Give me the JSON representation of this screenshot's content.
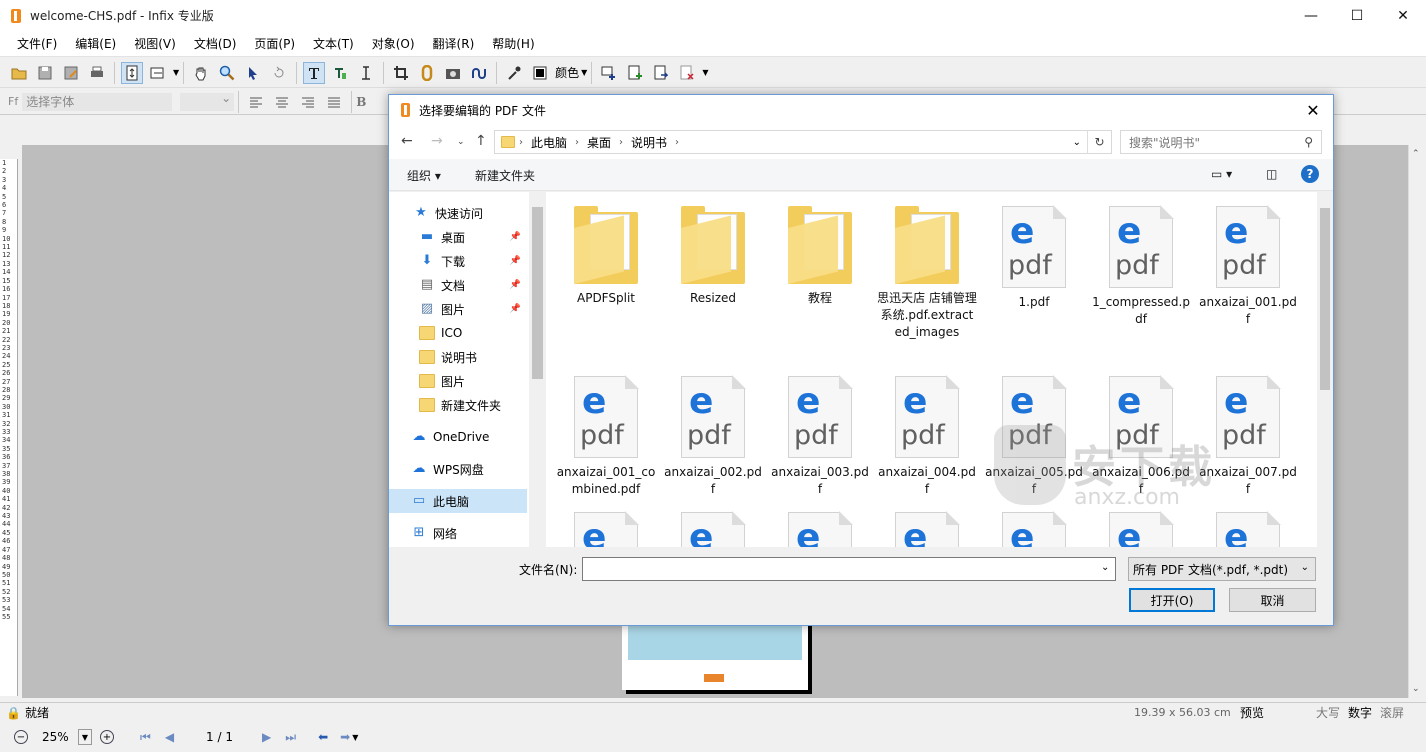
{
  "app": {
    "title": "welcome-CHS.pdf - Infix 专业版",
    "window_controls": [
      "minimize-icon",
      "maximize-icon",
      "close-icon"
    ]
  },
  "menu": [
    "文件(F)",
    "编辑(E)",
    "视图(V)",
    "文档(D)",
    "页面(P)",
    "文本(T)",
    "对象(O)",
    "翻译(R)",
    "帮助(H)"
  ],
  "toolbar": {
    "color_label": "颜色",
    "font_placeholder": "选择字体",
    "bold": "B"
  },
  "ruler_numbers": [
    "1",
    "2",
    "3",
    "4",
    "5",
    "6",
    "7",
    "8",
    "9",
    "10",
    "11",
    "12",
    "13",
    "14",
    "15",
    "16",
    "17",
    "18",
    "19",
    "20",
    "21",
    "22",
    "23",
    "24",
    "25",
    "26",
    "27",
    "28",
    "29",
    "30",
    "31",
    "32",
    "33",
    "34",
    "35",
    "36",
    "37",
    "38",
    "39",
    "40",
    "41",
    "42",
    "43",
    "44",
    "45",
    "46",
    "47",
    "48",
    "49",
    "50",
    "51",
    "52",
    "53",
    "54",
    "55"
  ],
  "status": {
    "ready": "就绪",
    "dimensions": "19.39 x 56.03 cm",
    "preview": "预览",
    "caps": "大写",
    "num": "数字",
    "scroll": "滚屏"
  },
  "nav": {
    "zoom": "25%",
    "page": "1 / 1"
  },
  "dialog": {
    "title": "选择要编辑的 PDF 文件",
    "breadcrumb": [
      "此电脑",
      "桌面",
      "说明书"
    ],
    "search_placeholder": "搜索\"说明书\"",
    "organize": "组织",
    "new_folder": "新建文件夹",
    "nav_items": [
      {
        "label": "快速访问",
        "icon": "star-icon"
      },
      {
        "label": "桌面",
        "icon": "desktop-icon",
        "pinned": true
      },
      {
        "label": "下载",
        "icon": "download-icon",
        "pinned": true
      },
      {
        "label": "文档",
        "icon": "document-icon",
        "pinned": true
      },
      {
        "label": "图片",
        "icon": "picture-icon",
        "pinned": true
      },
      {
        "label": "ICO",
        "icon": "folder-icon"
      },
      {
        "label": "说明书",
        "icon": "folder-icon"
      },
      {
        "label": "图片",
        "icon": "folder-icon"
      },
      {
        "label": "新建文件夹",
        "icon": "folder-icon"
      },
      {
        "label": "OneDrive",
        "icon": "cloud-icon"
      },
      {
        "label": "WPS网盘",
        "icon": "cloud-icon"
      },
      {
        "label": "此电脑",
        "icon": "computer-icon",
        "selected": true
      },
      {
        "label": "网络",
        "icon": "network-icon"
      }
    ],
    "files": [
      {
        "name": "APDFSplit",
        "type": "folder"
      },
      {
        "name": "Resized",
        "type": "folder"
      },
      {
        "name": "教程",
        "type": "folder"
      },
      {
        "name": "思迅天店 店铺管理系统.pdf.extracted_images",
        "type": "folder"
      },
      {
        "name": "1.pdf",
        "type": "pdf"
      },
      {
        "name": "1_compressed.pdf",
        "type": "pdf"
      },
      {
        "name": "anxaizai_001.pdf",
        "type": "pdf"
      },
      {
        "name": "anxaizai_001_combined.pdf",
        "type": "pdf"
      },
      {
        "name": "anxaizai_002.pdf",
        "type": "pdf"
      },
      {
        "name": "anxaizai_003.pdf",
        "type": "pdf"
      },
      {
        "name": "anxaizai_004.pdf",
        "type": "pdf"
      },
      {
        "name": "anxaizai_005.pdf",
        "type": "pdf"
      },
      {
        "name": "anxaizai_006.pdf",
        "type": "pdf"
      },
      {
        "name": "anxaizai_007.pdf",
        "type": "pdf"
      },
      {
        "name": "",
        "type": "pdf"
      },
      {
        "name": "",
        "type": "pdf"
      },
      {
        "name": "",
        "type": "pdf"
      },
      {
        "name": "",
        "type": "pdf"
      },
      {
        "name": "",
        "type": "pdf"
      },
      {
        "name": "",
        "type": "pdf"
      },
      {
        "name": "",
        "type": "pdf"
      }
    ],
    "filename_label": "文件名(N):",
    "filename_value": "",
    "filter": "所有 PDF 文档(*.pdf, *.pdt)",
    "open": "打开(O)",
    "cancel": "取消"
  },
  "watermark": {
    "text": "安下载",
    "sub": "anxz.com"
  },
  "colors": {
    "accent": "#0078d7",
    "pdf_icon_blue": "#1e73d8",
    "folder": "#f3cd5c"
  }
}
